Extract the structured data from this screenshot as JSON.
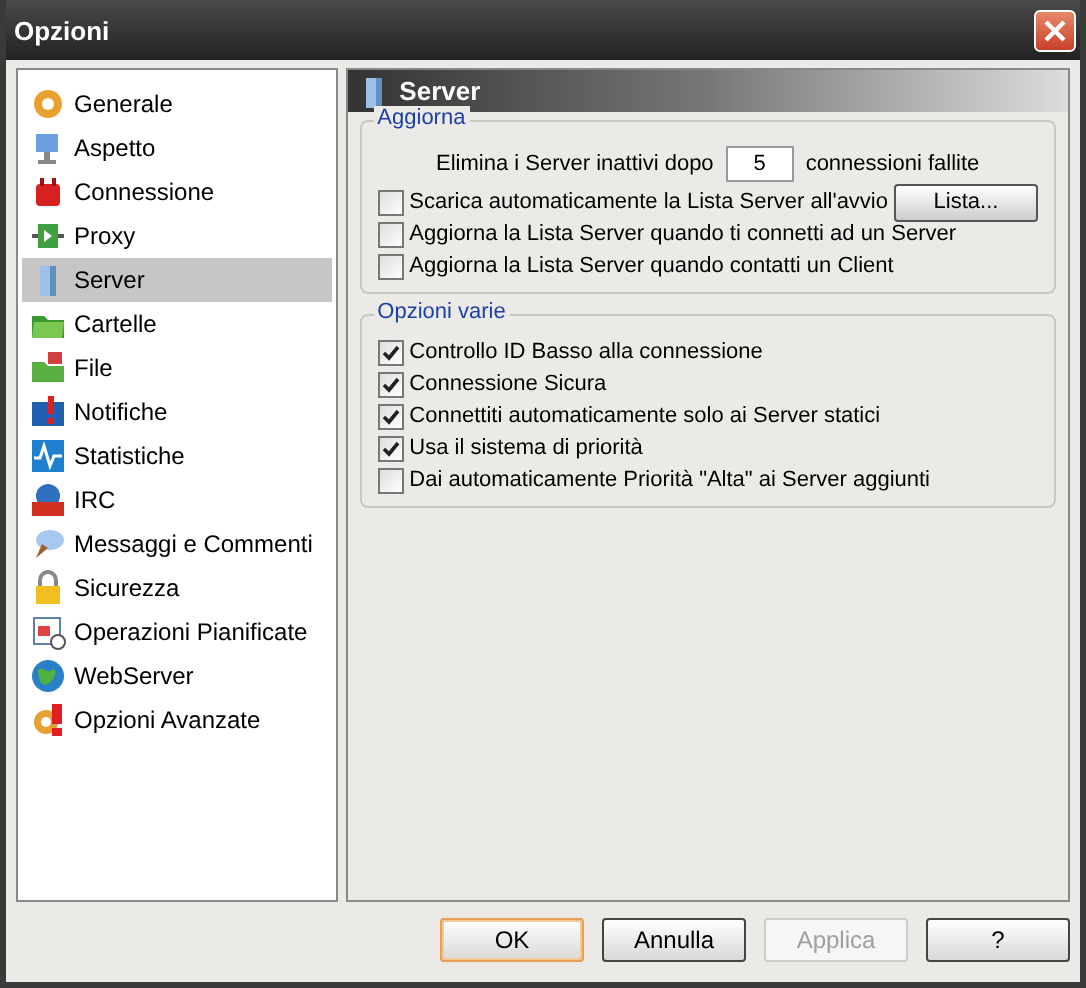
{
  "window": {
    "title": "Opzioni"
  },
  "sidebar": {
    "items": [
      {
        "label": "Generale",
        "selected": false
      },
      {
        "label": "Aspetto",
        "selected": false
      },
      {
        "label": "Connessione",
        "selected": false
      },
      {
        "label": "Proxy",
        "selected": false
      },
      {
        "label": "Server",
        "selected": true
      },
      {
        "label": "Cartelle",
        "selected": false
      },
      {
        "label": "File",
        "selected": false
      },
      {
        "label": "Notifiche",
        "selected": false
      },
      {
        "label": "Statistiche",
        "selected": false
      },
      {
        "label": "IRC",
        "selected": false
      },
      {
        "label": "Messaggi e Commenti",
        "selected": false
      },
      {
        "label": "Sicurezza",
        "selected": false
      },
      {
        "label": "Operazioni Pianificate",
        "selected": false
      },
      {
        "label": "WebServer",
        "selected": false
      },
      {
        "label": "Opzioni Avanzate",
        "selected": false
      }
    ]
  },
  "panel": {
    "title": "Server",
    "groups": [
      {
        "title": "Aggiorna",
        "rows": [
          {
            "kind": "number",
            "label_before": "Elimina i Server inattivi dopo",
            "value": "5",
            "label_after": "connessioni fallite"
          },
          {
            "kind": "checkbox",
            "label": "Scarica automaticamente la Lista Server all'avvio",
            "checked": false,
            "button": "Lista..."
          },
          {
            "kind": "checkbox",
            "label": "Aggiorna la Lista Server quando ti connetti ad un Server",
            "checked": false
          },
          {
            "kind": "checkbox",
            "label": "Aggiorna la Lista Server quando contatti un Client",
            "checked": false
          }
        ]
      },
      {
        "title": "Opzioni varie",
        "rows": [
          {
            "kind": "checkbox",
            "label": "Controllo ID Basso alla connessione",
            "checked": true
          },
          {
            "kind": "checkbox",
            "label": "Connessione Sicura",
            "checked": true
          },
          {
            "kind": "checkbox",
            "label": "Connettiti automaticamente solo ai Server statici",
            "checked": true
          },
          {
            "kind": "checkbox",
            "label": "Usa il sistema di priorità",
            "checked": true
          },
          {
            "kind": "checkbox",
            "label": "Dai automaticamente Priorità \"Alta\" ai Server aggiunti",
            "checked": false
          }
        ]
      }
    ]
  },
  "buttons": [
    {
      "label": "OK",
      "focused": true,
      "disabled": false
    },
    {
      "label": "Annulla",
      "focused": false,
      "disabled": false
    },
    {
      "label": "Applica",
      "focused": false,
      "disabled": true
    },
    {
      "label": "?",
      "focused": false,
      "disabled": false
    }
  ]
}
